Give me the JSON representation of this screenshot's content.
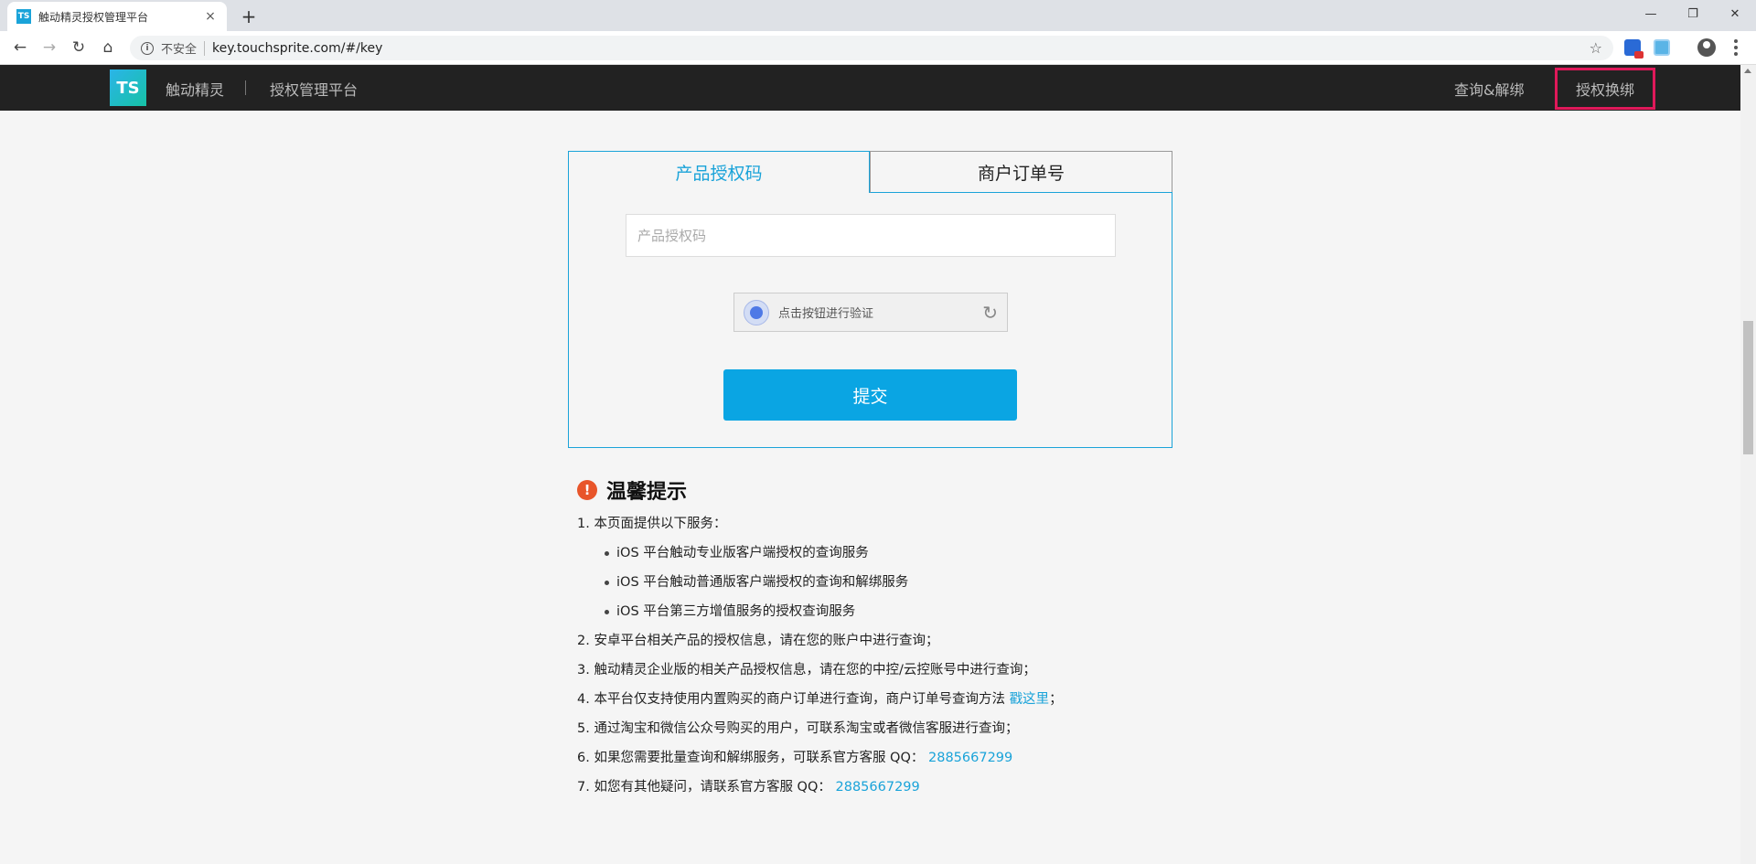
{
  "browser": {
    "tab_title": "触动精灵授权管理平台",
    "tab_favicon_text": "TS",
    "tab_close": "×",
    "new_tab": "+",
    "window_controls": {
      "minimize": "—",
      "maximize": "❐",
      "close": "✕"
    },
    "nav": {
      "back": "←",
      "forward": "→",
      "reload": "↻",
      "home": "⌂"
    },
    "security_label": "不安全",
    "url": "key.touchsprite.com/#/key",
    "bookmark_star": "☆"
  },
  "header": {
    "logo_text": "TS",
    "brand": "触动精灵",
    "platform": "授权管理平台",
    "nav": [
      "查询&解绑",
      "授权换绑"
    ]
  },
  "form": {
    "tabs": [
      "产品授权码",
      "商户订单号"
    ],
    "input_placeholder": "产品授权码",
    "captcha_text": "点击按钮进行验证",
    "refresh_glyph": "↻",
    "submit_label": "提交"
  },
  "tips": {
    "icon_glyph": "!",
    "title": "温馨提示",
    "line1": "1. 本页面提供以下服务：",
    "sub_items": [
      "iOS 平台触动专业版客户端授权的查询服务",
      "iOS 平台触动普通版客户端授权的查询和解绑服务",
      "iOS 平台第三方增值服务的授权查询服务"
    ],
    "line2": "2. 安卓平台相关产品的授权信息，请在您的账户中进行查询；",
    "line3": "3. 触动精灵企业版的相关产品授权信息，请在您的中控/云控账号中进行查询；",
    "line4_prefix": "4. 本平台仅支持使用内置购买的商户订单进行查询，商户订单号查询方法 ",
    "line4_link": "戳这里",
    "line4_suffix": "；",
    "line5": "5. 通过淘宝和微信公众号购买的用户，可联系淘宝或者微信客服进行查询；",
    "line6_prefix": "6. 如果您需要批量查询和解绑服务，可联系官方客服 QQ：",
    "line6_qq": "2885667299",
    "line7_prefix": "7. 如您有其他疑问，请联系官方客服 QQ：",
    "line7_qq": "2885667299"
  }
}
